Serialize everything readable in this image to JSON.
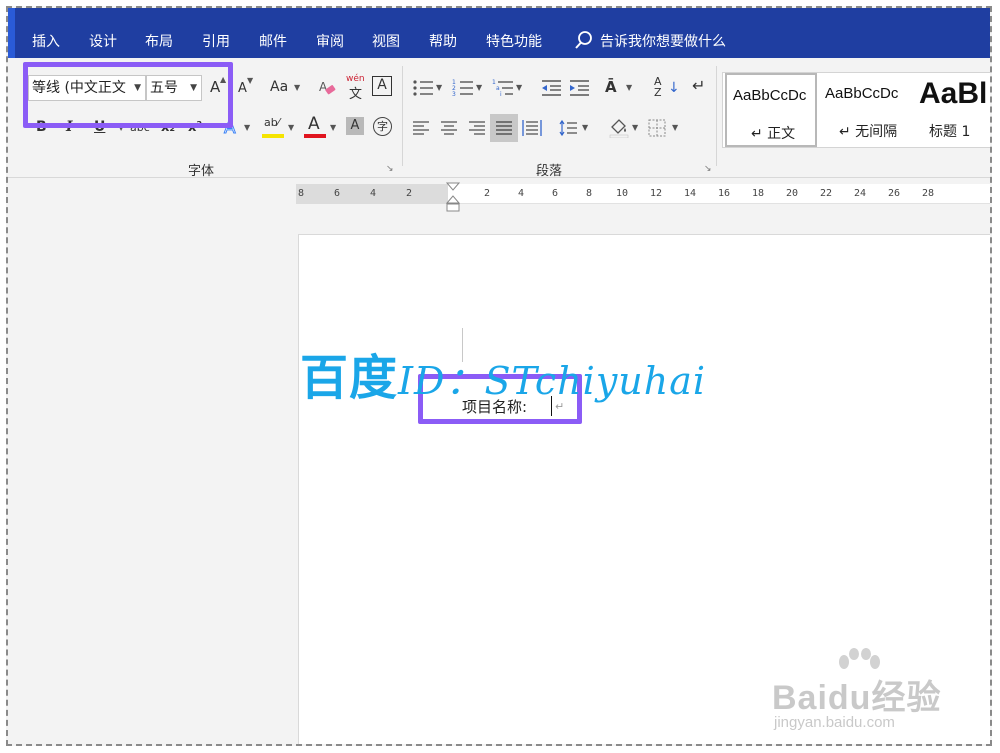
{
  "menu": {
    "items": [
      "插入",
      "设计",
      "布局",
      "引用",
      "邮件",
      "审阅",
      "视图",
      "帮助",
      "特色功能"
    ],
    "search_text": "告诉我你想要做什么"
  },
  "font_group": {
    "font_name": "等线 (中文正文",
    "font_size": "五号",
    "label": "字体",
    "grow_font": "A",
    "shrink_font": "A",
    "change_case": "Aa",
    "phonetic": "wén",
    "bold": "B",
    "italic": "I",
    "underline": "U",
    "strikethrough": "abc",
    "subscript": "x₂",
    "superscript": "x²"
  },
  "paragraph_group": {
    "label": "段落"
  },
  "styles": [
    {
      "preview": "AaBbCcDc",
      "name": "↵ 正文"
    },
    {
      "preview": "AaBbCcDc",
      "name": "↵ 无间隔"
    },
    {
      "preview": "AaBl",
      "name": "标题 1"
    }
  ],
  "ruler": {
    "left_numbers": [
      "8",
      "6",
      "4",
      "2"
    ],
    "right_numbers": [
      "2",
      "4",
      "6",
      "8",
      "10",
      "12",
      "14",
      "16",
      "18",
      "20",
      "22",
      "24",
      "26",
      "28"
    ]
  },
  "document": {
    "line_text": "项目名称:",
    "paragraph_mark": "↵"
  },
  "watermark": {
    "cn": "百度",
    "id": "ID：STchiyuhai",
    "baidu_main": "Baidu经验",
    "baidu_sub": "jingyan.baidu.com"
  },
  "colors": {
    "menubar": "#1f3ea1",
    "highlight": "#8b5cf6",
    "watermark": "#1aa6e8"
  }
}
